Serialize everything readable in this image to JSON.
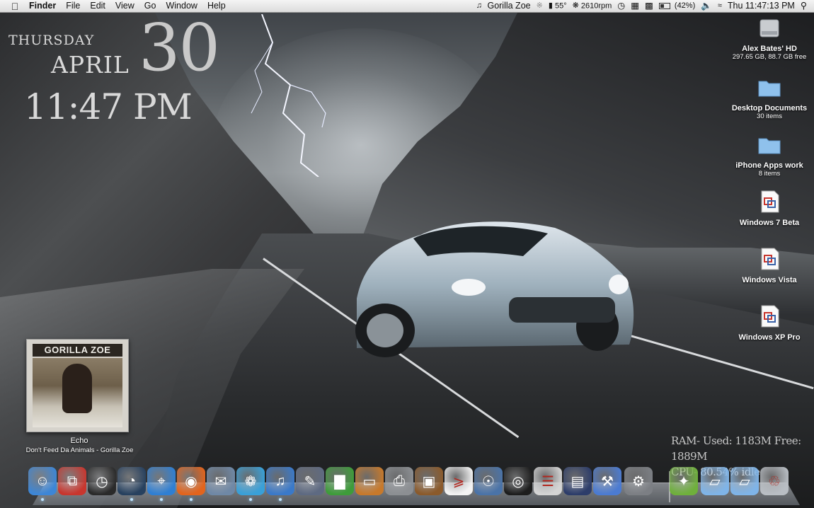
{
  "menubar": {
    "app_name": "Finder",
    "menus": [
      "File",
      "Edit",
      "View",
      "Go",
      "Window",
      "Help"
    ],
    "now_playing": "Gorilla Zoe",
    "temperature": "55°",
    "fan_speed": "2610rpm",
    "battery": "(42%)",
    "clock": "Thu 11:47:13 PM"
  },
  "clock_widget": {
    "weekday": "THURSDAY",
    "month": "APRIL",
    "day": "30",
    "time": "11:47 PM"
  },
  "desktop_icons": [
    {
      "name": "Alex Bates' HD",
      "sub": "297.65 GB, 88.7 GB free",
      "icon": "hard-drive-icon"
    },
    {
      "name": "Desktop Documents",
      "sub": "30 items",
      "icon": "folder-icon"
    },
    {
      "name": "iPhone Apps work",
      "sub": "8 items",
      "icon": "folder-icon"
    },
    {
      "name": "Windows 7 Beta",
      "sub": "",
      "icon": "vm-document-icon"
    },
    {
      "name": "Windows Vista",
      "sub": "",
      "icon": "vm-document-icon"
    },
    {
      "name": "Windows XP Pro",
      "sub": "",
      "icon": "vm-document-icon"
    }
  ],
  "album_widget": {
    "cover_text": "GORILLA ZOE",
    "track": "Echo",
    "album_artist": "Don't Feed Da Animals - Gorilla Zoe"
  },
  "system_stats": {
    "ram": "RAM- Used: 1183M Free: 1889M",
    "cpu": "CPU- 80.54% idle"
  },
  "dock": [
    {
      "name": "finder",
      "icon": "finder-icon",
      "color": "#3d86d6"
    },
    {
      "name": "parallels",
      "icon": "parallels-icon",
      "color": "#c8362e"
    },
    {
      "name": "dashboard",
      "icon": "dashboard-icon",
      "color": "#2a2a2a"
    },
    {
      "name": "time-machine",
      "icon": "time-machine-icon",
      "color": "#27415f"
    },
    {
      "name": "safari",
      "icon": "safari-icon",
      "color": "#2f7fd3"
    },
    {
      "name": "firefox",
      "icon": "firefox-icon",
      "color": "#e2641d"
    },
    {
      "name": "mail",
      "icon": "mail-icon",
      "color": "#6f88a6"
    },
    {
      "name": "ichat",
      "icon": "ichat-icon",
      "color": "#39a0d8"
    },
    {
      "name": "itunes",
      "icon": "itunes-icon",
      "color": "#3a79c9"
    },
    {
      "name": "script-editor",
      "icon": "script-editor-icon",
      "color": "#5e6a82"
    },
    {
      "name": "numbers",
      "icon": "numbers-icon",
      "color": "#3e9c3a"
    },
    {
      "name": "keynote",
      "icon": "keynote-icon",
      "color": "#c7792b"
    },
    {
      "name": "printer",
      "icon": "printer-icon",
      "color": "#8c8f93"
    },
    {
      "name": "iphoto",
      "icon": "iphoto-icon",
      "color": "#8b5a2b"
    },
    {
      "name": "acrobat",
      "icon": "acrobat-icon",
      "color": "#f3f3f3"
    },
    {
      "name": "preview",
      "icon": "preview-icon",
      "color": "#4a73a8"
    },
    {
      "name": "photo-booth",
      "icon": "photo-booth-icon",
      "color": "#1d1d1d"
    },
    {
      "name": "imovie",
      "icon": "imovie-icon",
      "color": "#d4d4d4"
    },
    {
      "name": "screen-sharing",
      "icon": "screen-sharing-icon",
      "color": "#2d3d6a"
    },
    {
      "name": "xcode",
      "icon": "xcode-icon",
      "color": "#4b7bd2"
    },
    {
      "name": "system-preferences",
      "icon": "system-preferences-icon",
      "color": "#7c7f84"
    },
    {
      "name": "applications-stack",
      "icon": "applications-stack-icon",
      "color": "#6fb03c"
    },
    {
      "name": "documents-stack",
      "icon": "folder-icon",
      "color": "#7fb4e8"
    },
    {
      "name": "downloads-stack",
      "icon": "folder-icon",
      "color": "#7fb4e8"
    },
    {
      "name": "trash",
      "icon": "trash-icon",
      "color": "#b9bec4"
    }
  ]
}
